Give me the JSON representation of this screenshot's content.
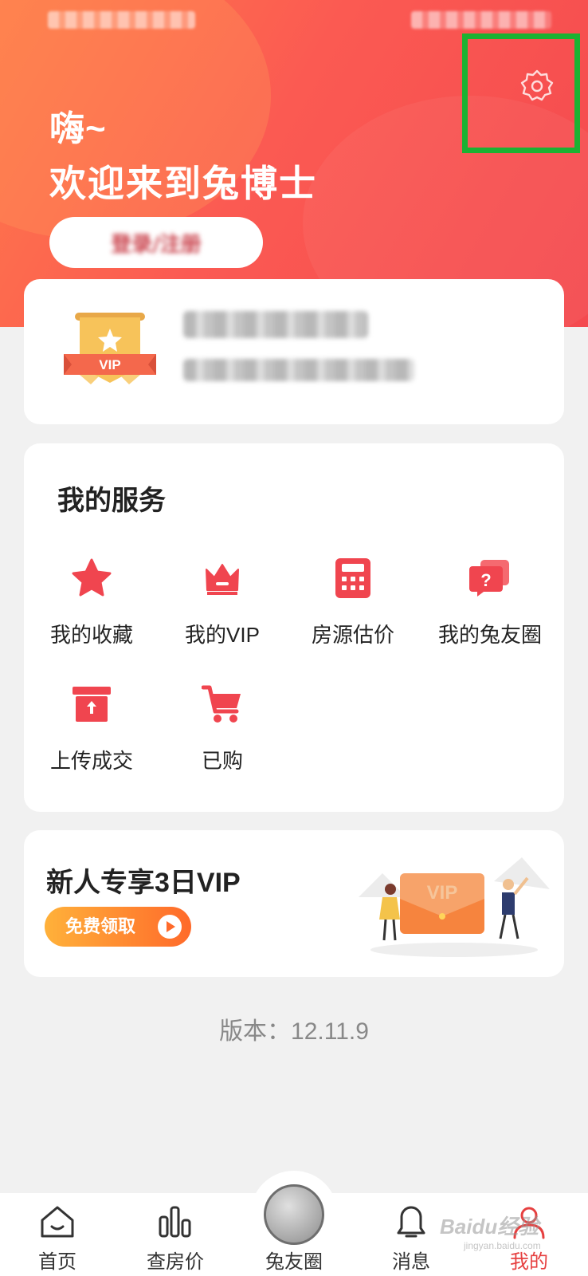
{
  "header": {
    "greeting": "嗨~",
    "welcome": "欢迎来到兔博士",
    "login_label": "登录/注册"
  },
  "vip_card": {
    "badge_text": "VIP"
  },
  "services": {
    "title": "我的服务",
    "items": [
      {
        "label": "我的收藏",
        "icon": "star-icon"
      },
      {
        "label": "我的VIP",
        "icon": "crown-icon"
      },
      {
        "label": "房源估价",
        "icon": "calculator-icon"
      },
      {
        "label": "我的兔友圈",
        "icon": "question-chat-icon"
      },
      {
        "label": "上传成交",
        "icon": "upload-box-icon"
      },
      {
        "label": "已购",
        "icon": "cart-icon"
      }
    ]
  },
  "promo": {
    "title": "新人专享3日VIP",
    "button_label": "免费领取",
    "illustration_text": "VIP"
  },
  "version_text": "版本：12.11.9",
  "tabbar": {
    "tabs": [
      {
        "label": "首页",
        "icon": "home-icon"
      },
      {
        "label": "查房价",
        "icon": "bar-chart-icon"
      },
      {
        "label": "兔友圈",
        "icon": "rabbit-avatar-icon"
      },
      {
        "label": "消息",
        "icon": "bell-icon"
      },
      {
        "label": "我的",
        "icon": "person-icon"
      }
    ]
  },
  "watermark": {
    "text": "Baidu经验",
    "sub": "jingyan.baidu.com"
  },
  "colors": {
    "accent": "#f4494f",
    "icon_red": "#f0454f",
    "highlight_box": "#1cb232"
  }
}
